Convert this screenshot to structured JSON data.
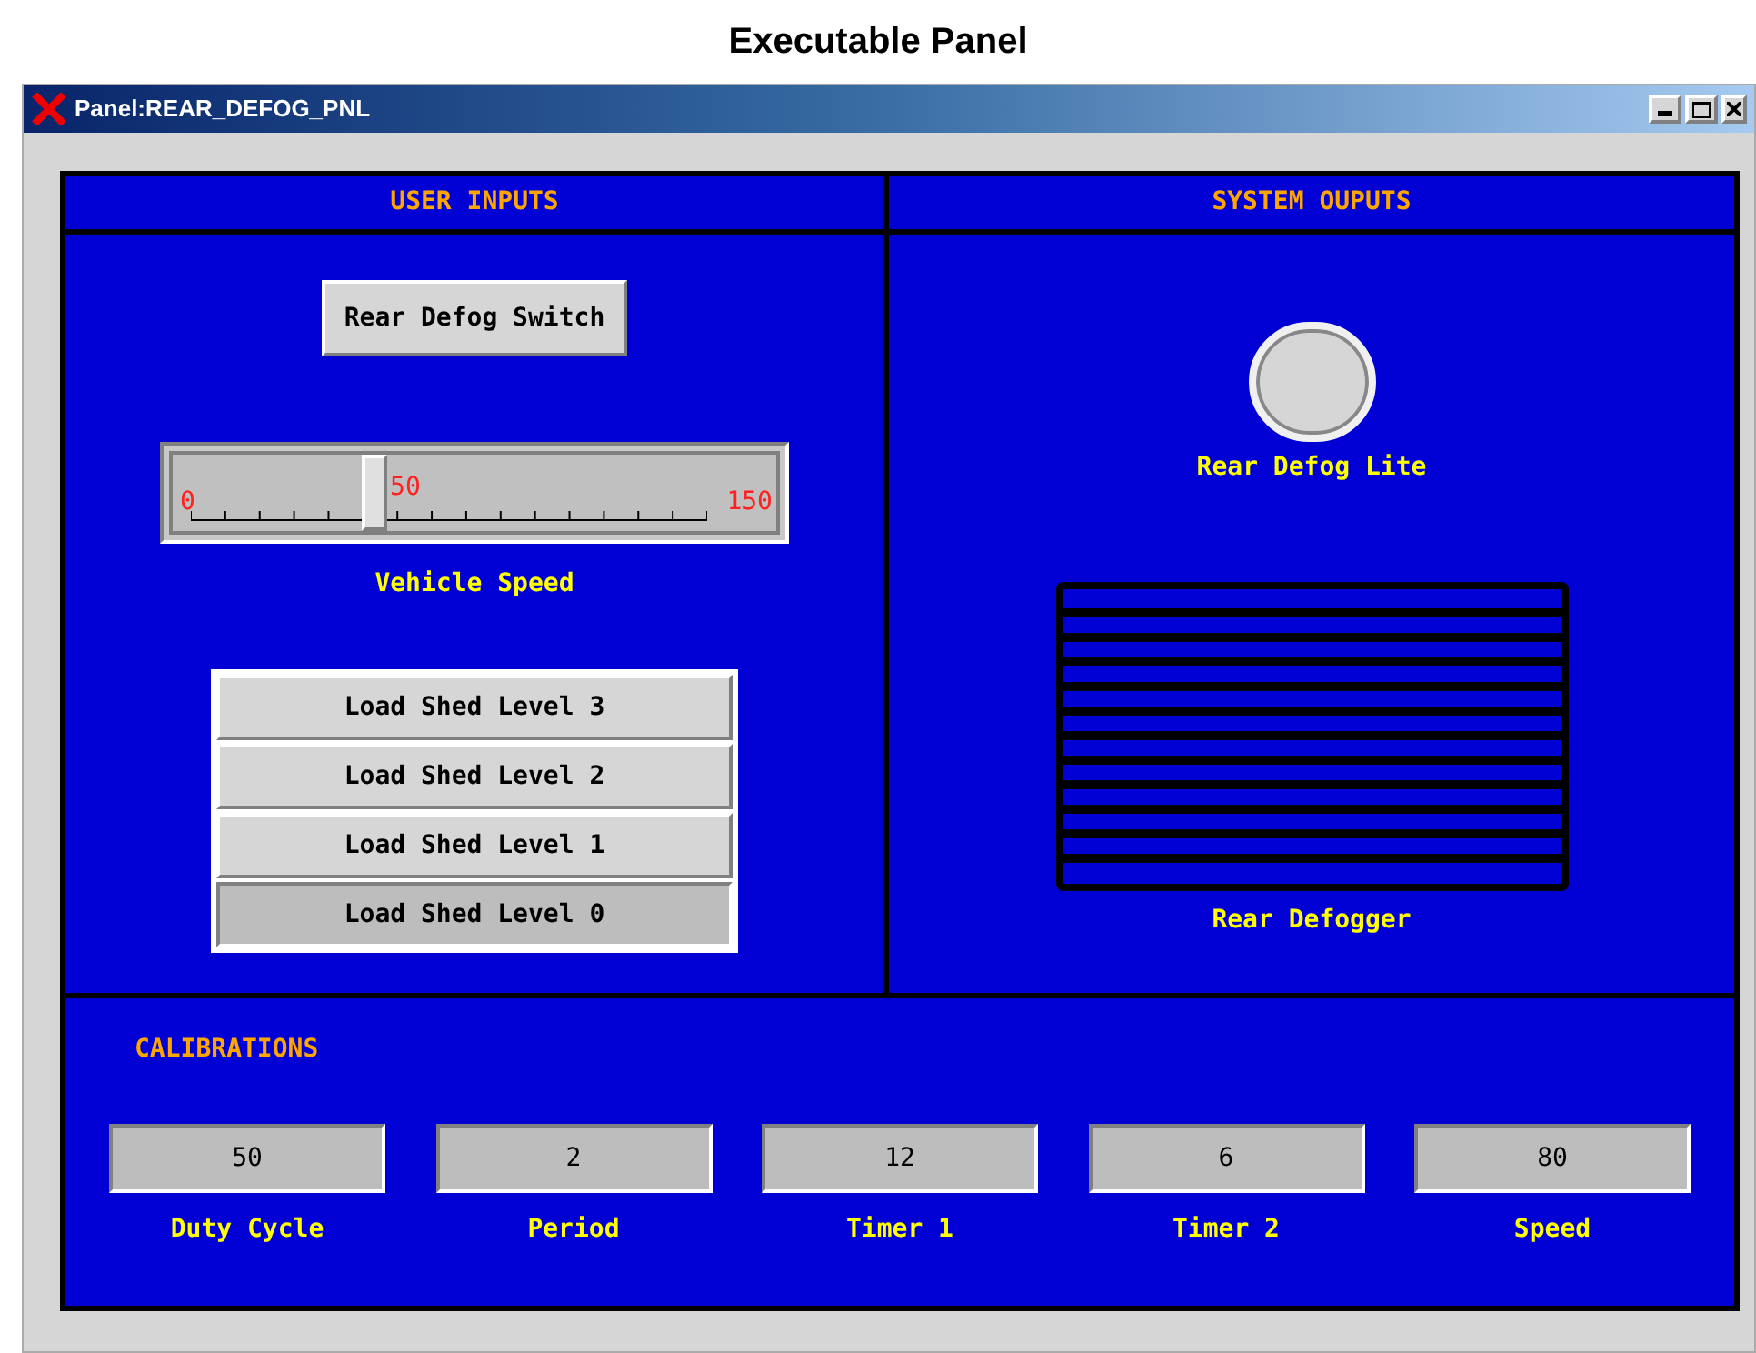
{
  "page_title": "Executable Panel",
  "window": {
    "title": "Panel:REAR_DEFOG_PNL"
  },
  "user_inputs": {
    "header": "USER INPUTS",
    "switch_button": "Rear Defog Switch",
    "slider": {
      "label": "Vehicle Speed",
      "level": 0.333,
      "min_label": "0",
      "value_label": "50",
      "max_label": "150"
    },
    "load_shed": [
      {
        "label": "Load Shed Level 3",
        "selected": false
      },
      {
        "label": "Load Shed Level 2",
        "selected": false
      },
      {
        "label": "Load Shed Level 1",
        "selected": false
      },
      {
        "label": "Load Shed Level 0",
        "selected": true
      }
    ]
  },
  "system_outputs": {
    "header": "SYSTEM OUPUTS",
    "lamp": {
      "label": "Rear Defog Lite",
      "on": false
    },
    "defogger": {
      "label": "Rear Defogger",
      "on": false
    }
  },
  "calibrations": {
    "header": "CALIBRATIONS",
    "fields": [
      {
        "value": "50",
        "label": "Duty Cycle"
      },
      {
        "value": "2",
        "label": "Period"
      },
      {
        "value": "12",
        "label": "Timer 1"
      },
      {
        "value": "6",
        "label": "Timer 2"
      },
      {
        "value": "80",
        "label": "Speed"
      }
    ]
  }
}
